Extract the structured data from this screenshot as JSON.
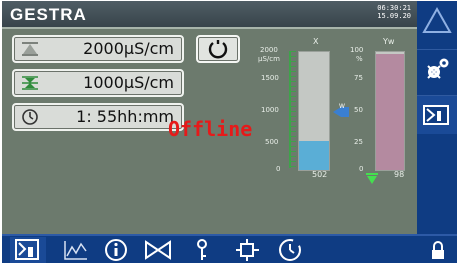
{
  "header": {
    "brand": "GESTRA",
    "time": "06:30:21",
    "date": "15.09.20"
  },
  "fields": [
    {
      "value": "2000μS/cm"
    },
    {
      "value": "1000μS/cm"
    },
    {
      "value": "1: 55hh:mm"
    }
  ],
  "status": "Offline",
  "gauge_x": {
    "label": "X",
    "scale": [
      "2000",
      "μS/cm",
      "1500",
      "1000",
      "500",
      "0"
    ],
    "value_text": "502",
    "fill_fraction": 0.25,
    "marker_label": "W"
  },
  "gauge_yw": {
    "label": "Yw",
    "scale": [
      "100",
      "%",
      "75",
      "50",
      "25",
      "0"
    ],
    "value_text": "98",
    "fill_fraction": 0.98
  },
  "side_buttons": [
    "warning-icon",
    "settings-icon",
    "operation-icon"
  ],
  "bottom_buttons": [
    "operation-icon",
    "trend-icon",
    "info-icon",
    "valve-icon",
    "sensor-icon",
    "switch-icon",
    "timer-icon",
    "lock-icon"
  ],
  "colors": {
    "panel": "#6c7a6d",
    "nav": "#0f3c83",
    "bar_x": "#5aaed6",
    "bar_yw": "#b48aa0",
    "offline": "#e61a1a"
  }
}
